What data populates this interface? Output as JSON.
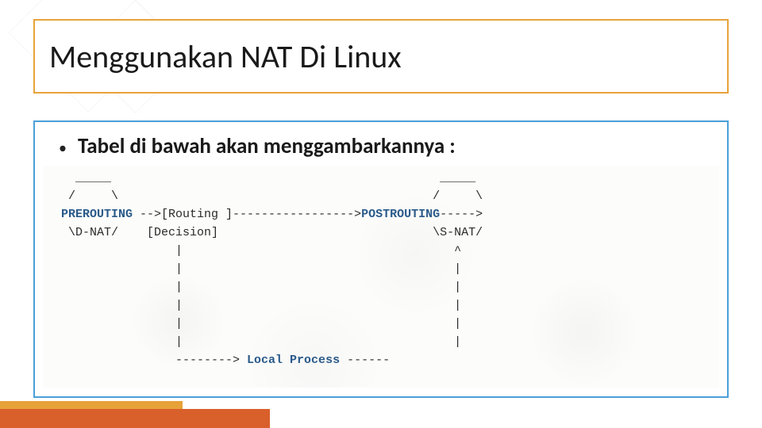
{
  "title": "Menggunakan NAT Di Linux",
  "bullet": "Tabel di bawah akan menggambarkannya :",
  "diagram": {
    "line1": "   _____                                              _____",
    "line2a": "  /     \\                                            /     \\",
    "line3_pre": " ",
    "line3_prerouting": "PREROUTING",
    "line3_mid1": " -->[Routing ]----------------->",
    "line3_postrouting": "POSTROUTING",
    "line3_end": "----->",
    "line4": "  \\D-NAT/    [Decision]                              \\S-NAT/",
    "line5": "                 |                                      ^",
    "line6": "                 |                                      |",
    "line7": "                 |                                      |",
    "line8": "                 |                                      |",
    "line9": "                 |                                      |",
    "line10": "                 |                                      |",
    "line11a": "                 --------> ",
    "line11_local": "Local Process",
    "line11b": " ------"
  }
}
